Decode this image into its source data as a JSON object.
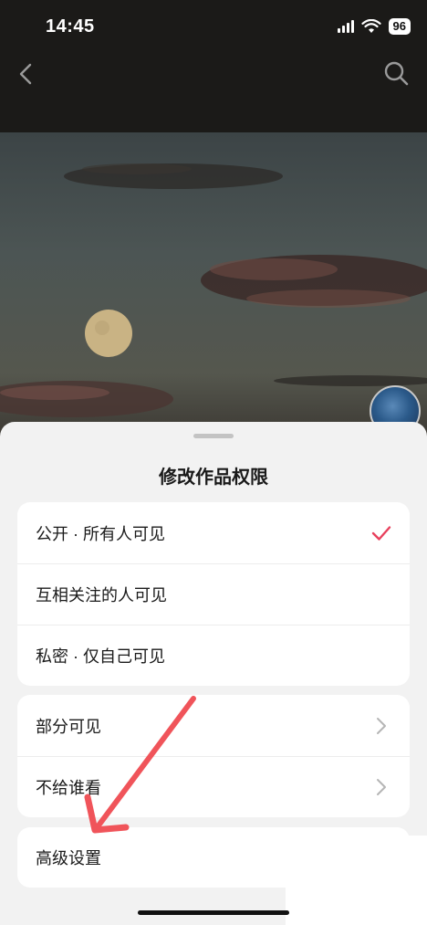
{
  "status_bar": {
    "time": "14:45",
    "battery": "96"
  },
  "nav": {
    "back_icon": "chevron-left-icon",
    "search_icon": "search-icon"
  },
  "sheet": {
    "title": "修改作品权限",
    "visibility_options": [
      {
        "label": "公开 · 所有人可见",
        "selected": true
      },
      {
        "label": "互相关注的人可见",
        "selected": false
      },
      {
        "label": "私密 · 仅自己可见",
        "selected": false
      }
    ],
    "partial_options": [
      {
        "label": "部分可见"
      },
      {
        "label": "不给谁看"
      }
    ],
    "advanced": {
      "label": "高级设置"
    }
  },
  "colors": {
    "accent_check": "#e8415d",
    "annotation_arrow": "#f0545a",
    "sheet_bg": "#f2f2f2"
  }
}
